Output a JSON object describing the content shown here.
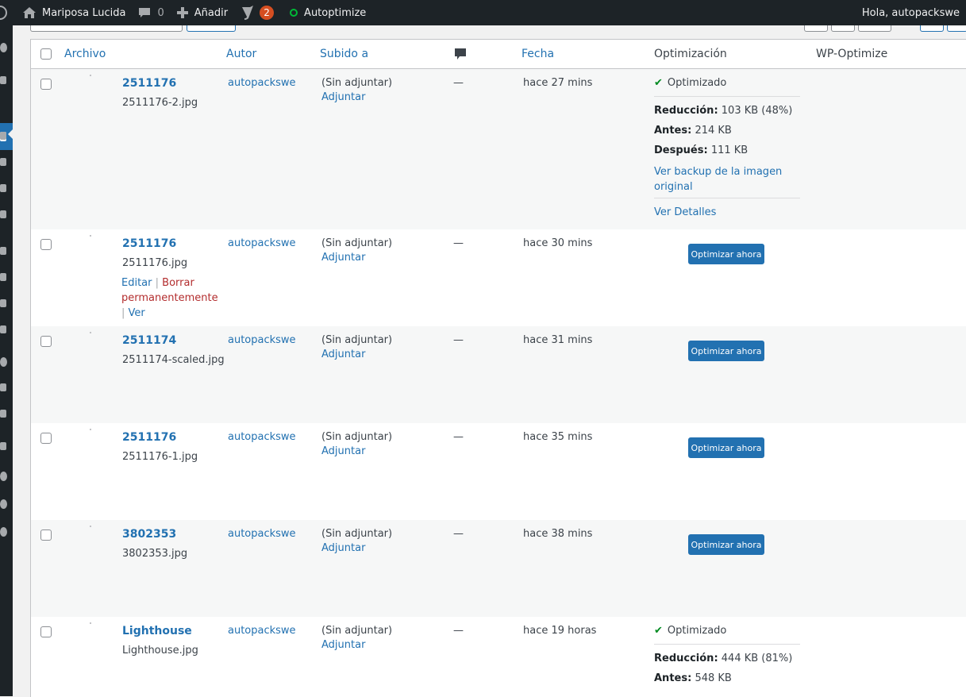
{
  "adminbar": {
    "site_name": "Mariposa Lucida",
    "comments_count": "0",
    "add_new": "Añadir",
    "yoast_count": "2",
    "autoptimize": "Autoptimize",
    "greeting": "Hola, autopackswe"
  },
  "columns": {
    "file": "Archivo",
    "author": "Autor",
    "uploaded_to": "Subido a",
    "date": "Fecha",
    "optimization": "Optimización",
    "wp_optimize": "WP-Optimize"
  },
  "common": {
    "unattached": "(Sin adjuntar)",
    "attach": "Adjuntar",
    "dash": "—",
    "optimize_now": "Optimizar ahora",
    "optimized": "Optimizado",
    "reduction_label": "Reducción:",
    "before_label": "Antes:",
    "after_label": "Después:",
    "view_backup": "Ver backup de la imagen",
    "view_backup_2": "original",
    "view_details": "Ver Detalles"
  },
  "rows": [
    {
      "title": "2511176",
      "filename": "2511176-2.jpg",
      "author": "autopackswe",
      "date": "hace 27 mins",
      "reduction": "103 KB (48%)",
      "before": "214 KB",
      "after": "111 KB"
    },
    {
      "title": "2511176",
      "filename": "2511176.jpg",
      "author": "autopackswe",
      "date": "hace 30 mins",
      "actions": {
        "edit": "Editar",
        "delete_1": "Borrar",
        "delete_2": "permanentemente",
        "view": "Ver"
      }
    },
    {
      "title": "2511174",
      "filename": "2511174-scaled.jpg",
      "author": "autopackswe",
      "date": "hace 31 mins"
    },
    {
      "title": "2511176",
      "filename": "2511176-1.jpg",
      "author": "autopackswe",
      "date": "hace 35 mins"
    },
    {
      "title": "3802353",
      "filename": "3802353.jpg",
      "author": "autopackswe",
      "date": "hace 38 mins"
    },
    {
      "title": "Lighthouse",
      "filename": "Lighthouse.jpg",
      "author": "autopackswe",
      "date": "hace 19 horas",
      "reduction": "444 KB (81%)",
      "before": "548 KB"
    }
  ]
}
